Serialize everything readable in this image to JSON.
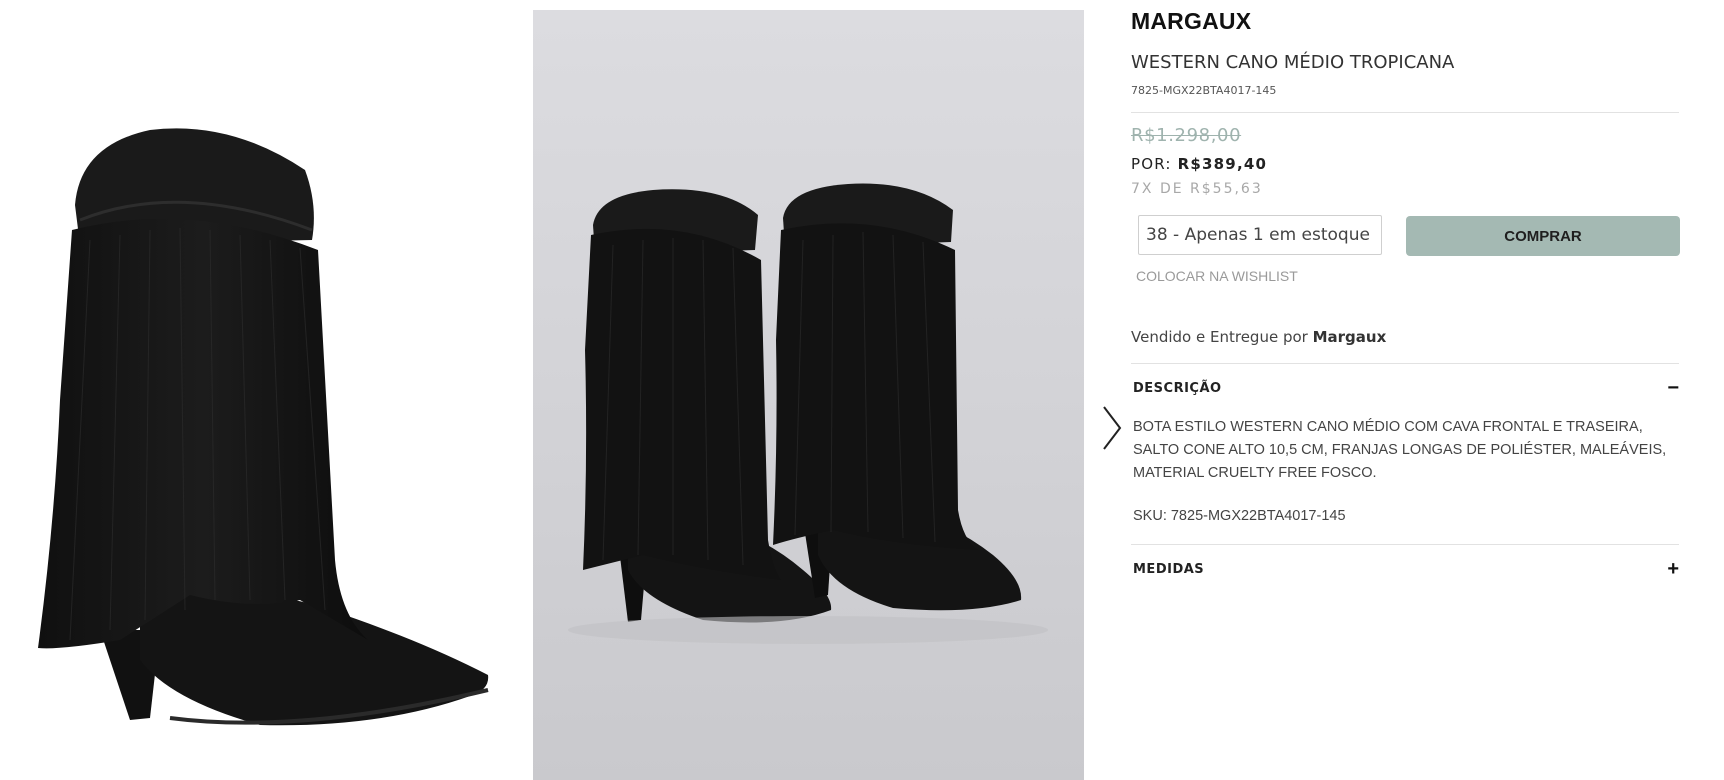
{
  "product": {
    "brand": "MARGAUX",
    "name": "WESTERN CANO MÉDIO TROPICANA",
    "reference": "7825-MGX22BTA4017-145"
  },
  "pricing": {
    "old_price": "R$1.298,00",
    "price_prefix": "POR:",
    "price": "R$389,40",
    "installments": "7X DE R$55,63"
  },
  "purchase": {
    "size_selected": "38 - Apenas 1 em estoque",
    "buy_label": "COMPRAR",
    "wishlist_label": "COLOCAR NA WISHLIST"
  },
  "seller": {
    "prefix": "Vendido e Entregue por",
    "name": "Margaux"
  },
  "accordion": {
    "description": {
      "title": "DESCRIÇÃO",
      "toggle": "−",
      "text": "BOTA ESTILO WESTERN CANO MÉDIO COM CAVA FRONTAL E TRASEIRA, SALTO CONE ALTO 10,5 CM, FRANJAS LONGAS DE POLIÉSTER, MALEÁVEIS, MATERIAL CRUELTY FREE FOSCO.",
      "sku": "SKU: 7825-MGX22BTA4017-145"
    },
    "measures": {
      "title": "MEDIDAS",
      "toggle": "+"
    }
  },
  "colors": {
    "buy_button": "#a4b9b3",
    "old_price": "#9fb3ae",
    "divider": "#e2e2e2"
  },
  "icons": {
    "gallery_next": "chevron-right-icon"
  }
}
